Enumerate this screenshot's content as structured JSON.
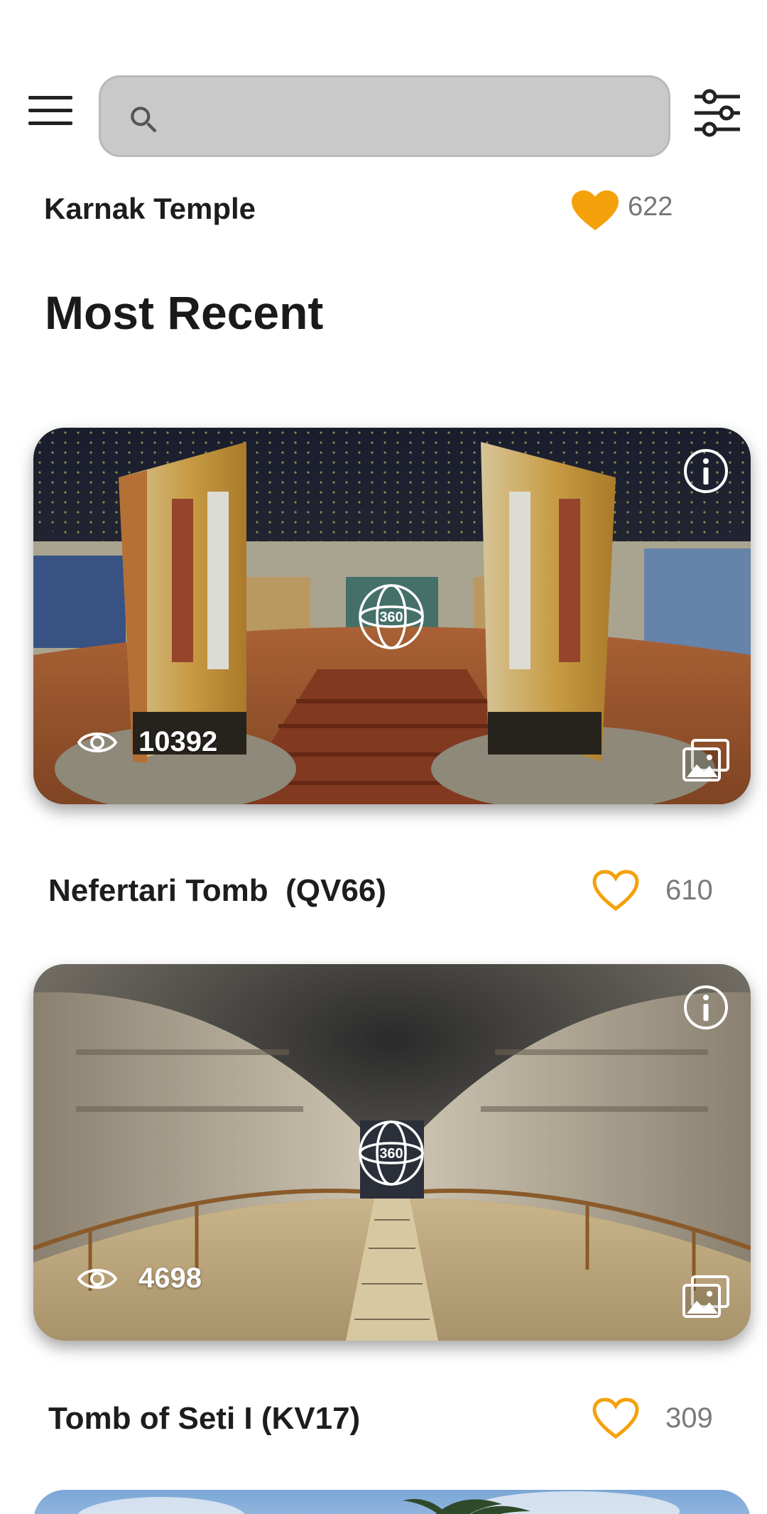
{
  "search": {
    "placeholder": "",
    "value": ""
  },
  "previous_item": {
    "title": "Karnak Temple",
    "likes": "622"
  },
  "section": {
    "title": "Most Recent"
  },
  "cards": [
    {
      "title": "Nefertari Tomb  (QV66)",
      "views": "10392",
      "likes": "610"
    },
    {
      "title": "Tomb of Seti I (KV17)",
      "views": "4698",
      "likes": "309"
    }
  ],
  "icons": {
    "menu": "hamburger-menu-icon",
    "search": "search-icon",
    "filter": "sliders-filter-icon",
    "info": "info-icon",
    "pano": "360-view-icon",
    "views": "eye-icon",
    "gallery": "image-gallery-icon",
    "like": "heart-icon"
  },
  "colors": {
    "accent": "#f5a10b",
    "search_bg": "#c9c9c9",
    "text": "#1d1d1d"
  }
}
